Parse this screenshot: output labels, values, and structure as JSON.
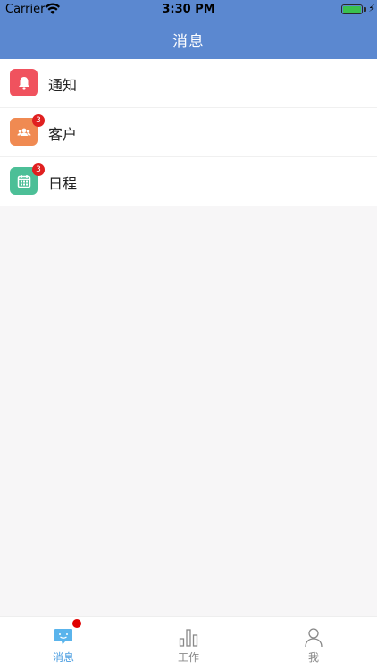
{
  "status_bar": {
    "carrier": "Carrier",
    "time": "3:30 PM",
    "battery_level": 1.0
  },
  "nav": {
    "title": "消息",
    "background_color": "#5b88d0"
  },
  "messages": {
    "items": [
      {
        "label": "通知",
        "icon": "bell-icon",
        "color": "#f0525e",
        "badge": ""
      },
      {
        "label": "客户",
        "icon": "customers-icon",
        "color": "#f08a52",
        "badge": "3"
      },
      {
        "label": "日程",
        "icon": "calendar-icon",
        "color": "#4cbf97",
        "badge": "3"
      }
    ]
  },
  "tabbar": {
    "tabs": [
      {
        "label": "消息",
        "icon": "chat-bubble-icon",
        "active": true,
        "has_dot": true
      },
      {
        "label": "工作",
        "icon": "bar-chart-icon",
        "active": false
      },
      {
        "label": "我",
        "icon": "person-icon",
        "active": false
      }
    ],
    "active_color": "#4a9de0"
  }
}
